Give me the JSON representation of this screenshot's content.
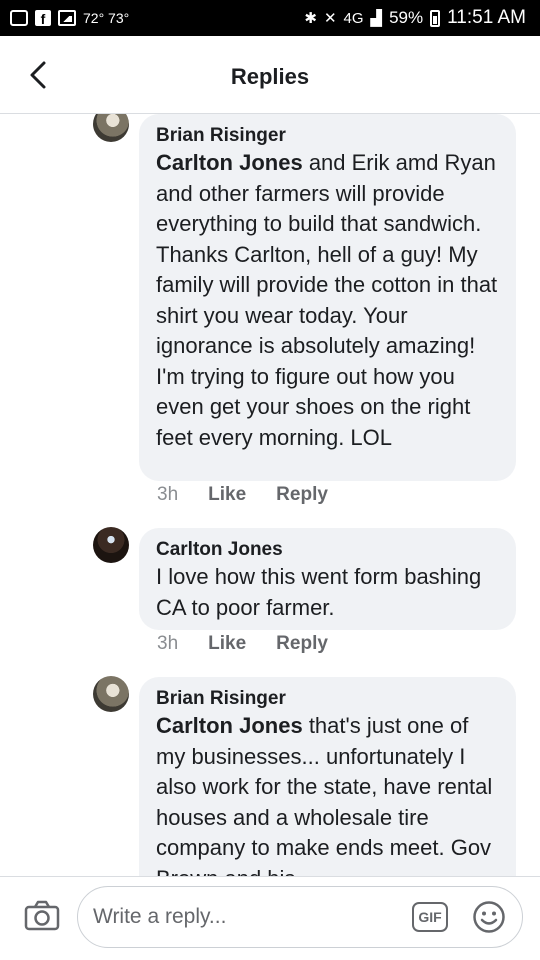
{
  "status_bar": {
    "temps": "72° 73°",
    "signal": "4G",
    "battery": "59%",
    "time": "11:51 AM",
    "icons": [
      "message-icon",
      "facebook-icon",
      "gallery-icon",
      "bluetooth-icon",
      "mute-icon",
      "signal-icon",
      "battery-icon"
    ]
  },
  "header": {
    "title": "Replies",
    "back_icon": "chevron-left-icon"
  },
  "comments": [
    {
      "author": "Brian Risinger",
      "mention": "Carlton Jones",
      "text": " and Erik amd Ryan and other farmers will provide everything to build that sandwich. Thanks Carlton, hell of a guy! My family will provide the cotton in that shirt you wear today. Your ignorance is absolutely amazing! I'm trying to figure out how you even get your shoes on the right feet every morning. LOL",
      "time": "3h",
      "like": "Like",
      "reply": "Reply"
    },
    {
      "author": "Carlton Jones",
      "mention": "",
      "text": "I love how this went form bashing CA to poor farmer.",
      "time": "3h",
      "like": "Like",
      "reply": "Reply"
    },
    {
      "author": "Brian Risinger",
      "mention": "Carlton Jones",
      "text": " that's just one of my businesses... unfortunately I also work for the state, have rental houses and a wholesale tire company to make ends meet. Gov Brown and his"
    }
  ],
  "composer": {
    "placeholder": "Write a reply...",
    "gif_label": "GIF",
    "camera_icon": "camera-icon",
    "emoji_icon": "emoji-icon"
  },
  "colors": {
    "bubble": "#f0f2f5",
    "secondary_text": "#65676b",
    "text": "#1c1e21"
  }
}
